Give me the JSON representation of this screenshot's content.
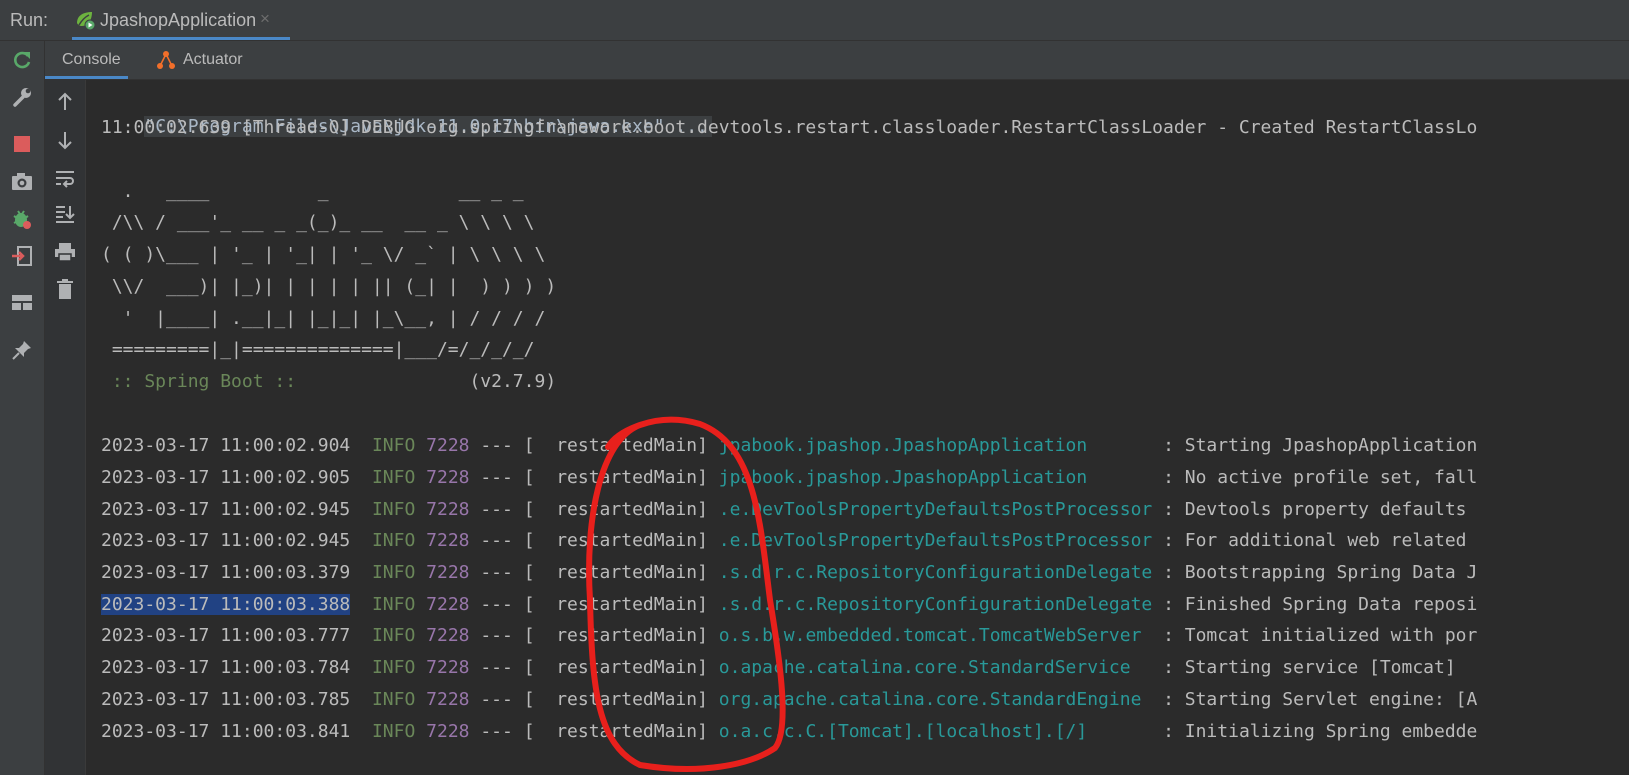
{
  "run_bar": {
    "label": "Run:",
    "tab_title": "JpashopApplication",
    "close_glyph": "×"
  },
  "left_toolbar": {
    "tools": [
      {
        "name": "rerun-icon"
      },
      {
        "name": "wrench-icon"
      },
      {
        "name": "stop-icon"
      },
      {
        "name": "camera-icon"
      },
      {
        "name": "debug-bug-icon"
      },
      {
        "name": "exit-icon"
      },
      {
        "name": "layout-icon"
      },
      {
        "name": "pin-icon"
      }
    ]
  },
  "sub_tabs": {
    "console": "Console",
    "actuator": "Actuator"
  },
  "console_toolbar": {
    "tools": [
      {
        "name": "scroll-up-icon"
      },
      {
        "name": "scroll-down-icon"
      },
      {
        "name": "soft-wrap-icon"
      },
      {
        "name": "scroll-to-end-icon"
      },
      {
        "name": "print-icon"
      },
      {
        "name": "trash-icon"
      }
    ]
  },
  "console": {
    "command_line": "\"C:\\Program Files\\Java\\jdk-11.0.17\\bin\\java.exe\" ...",
    "debug_line": "11:00:02.639 [Thread-0] DEBUG org.springframework.boot.devtools.restart.classloader.RestartClassLoader - Created RestartClassLo",
    "banner": [
      "  .   ____          _            __ _ _",
      " /\\\\ / ___'_ __ _ _(_)_ __  __ _ \\ \\ \\ \\",
      "( ( )\\___ | '_ | '_| | '_ \\/ _` | \\ \\ \\ \\",
      " \\\\/  ___)| |_)| | | | | || (_| |  ) ) ) )",
      "  '  |____| .__|_| |_|_| |_\\__, | / / / /",
      " =========|_|==============|___/=/_/_/_/"
    ],
    "spring_label": " :: Spring Boot :: ",
    "spring_version": "               (v2.7.9)",
    "log_lines": [
      {
        "ts": "2023-03-17 11:00:02.904",
        "level": "INFO",
        "pid": "7228",
        "sep": "--- [",
        "thread": "  restartedMain]",
        "logger": "jpabook.jpashop.JpashopApplication      ",
        "msg": " : Starting JpashopApplication"
      },
      {
        "ts": "2023-03-17 11:00:02.905",
        "level": "INFO",
        "pid": "7228",
        "sep": "--- [",
        "thread": "  restartedMain]",
        "logger": "jpabook.jpashop.JpashopApplication      ",
        "msg": " : No active profile set, fall"
      },
      {
        "ts": "2023-03-17 11:00:02.945",
        "level": "INFO",
        "pid": "7228",
        "sep": "--- [",
        "thread": "  restartedMain]",
        "logger": ".e.DevToolsPropertyDefaultsPostProcessor",
        "msg": " : Devtools property defaults"
      },
      {
        "ts": "2023-03-17 11:00:02.945",
        "level": "INFO",
        "pid": "7228",
        "sep": "--- [",
        "thread": "  restartedMain]",
        "logger": ".e.DevToolsPropertyDefaultsPostProcessor",
        "msg": " : For additional web related"
      },
      {
        "ts": "2023-03-17 11:00:03.379",
        "level": "INFO",
        "pid": "7228",
        "sep": "--- [",
        "thread": "  restartedMain]",
        "logger": ".s.d.r.c.RepositoryConfigurationDelegate",
        "msg": " : Bootstrapping Spring Data J"
      },
      {
        "ts": "2023-03-17 11:00:03.388",
        "level": "INFO",
        "pid": "7228",
        "sep": "--- [",
        "thread": "  restartedMain]",
        "logger": ".s.d.r.c.RepositoryConfigurationDelegate",
        "msg": " : Finished Spring Data reposi"
      },
      {
        "ts": "2023-03-17 11:00:03.777",
        "level": "INFO",
        "pid": "7228",
        "sep": "--- [",
        "thread": "  restartedMain]",
        "logger": "o.s.b.w.embedded.tomcat.TomcatWebServer ",
        "msg": " : Tomcat initialized with por"
      },
      {
        "ts": "2023-03-17 11:00:03.784",
        "level": "INFO",
        "pid": "7228",
        "sep": "--- [",
        "thread": "  restartedMain]",
        "logger": "o.apache.catalina.core.StandardService  ",
        "msg": " : Starting service [Tomcat]"
      },
      {
        "ts": "2023-03-17 11:00:03.785",
        "level": "INFO",
        "pid": "7228",
        "sep": "--- [",
        "thread": "  restartedMain]",
        "logger": "org.apache.catalina.core.StandardEngine ",
        "msg": " : Starting Servlet engine: [A"
      },
      {
        "ts": "2023-03-17 11:00:03.841",
        "level": "INFO",
        "pid": "7228",
        "sep": "--- [",
        "thread": "  restartedMain]",
        "logger": "o.a.c.c.C.[Tomcat].[localhost].[/]      ",
        "msg": " : Initializing Spring embedde"
      }
    ],
    "selected_line_index": 5
  },
  "colors": {
    "background": "#2b2b2b",
    "toolbar": "#3c3f41",
    "text": "#bbbbbb",
    "info": "#6a8759",
    "pid": "#9876aa",
    "logger": "#299999",
    "selection": "#214283",
    "tab_underline": "#4a88c7",
    "annotation": "#e8201c"
  }
}
